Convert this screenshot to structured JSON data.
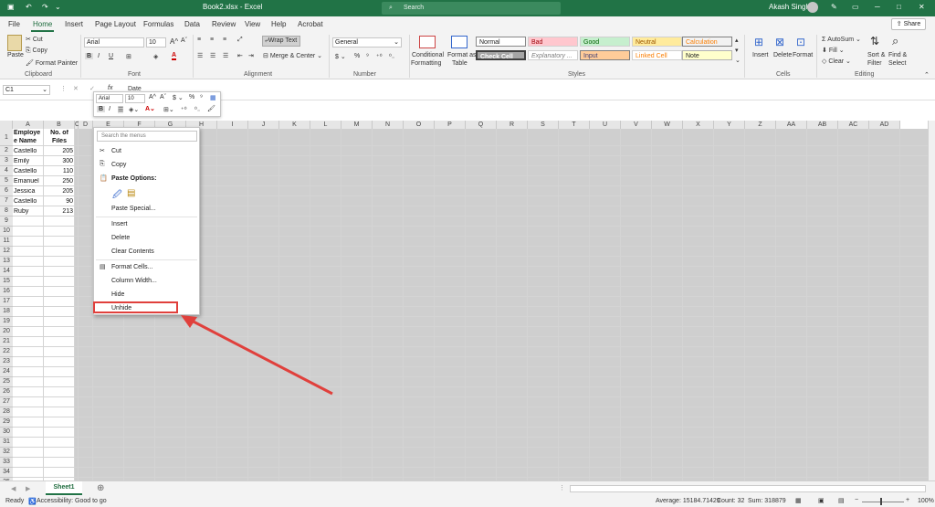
{
  "window": {
    "filename": "Book2.xlsx - Excel",
    "search_placeholder": "Search",
    "user": "Akash Singh"
  },
  "tabs": [
    "File",
    "Home",
    "Insert",
    "Page Layout",
    "Formulas",
    "Data",
    "Review",
    "View",
    "Help",
    "Acrobat"
  ],
  "share_label": "Share",
  "clipboard": {
    "paste": "Paste",
    "cut": "Cut",
    "copy": "Copy",
    "format_painter": "Format Painter",
    "group": "Clipboard"
  },
  "font": {
    "name": "Arial",
    "size": "10",
    "group": "Font"
  },
  "alignment": {
    "wrap": "Wrap Text",
    "merge": "Merge & Center",
    "group": "Alignment"
  },
  "number": {
    "format": "General",
    "group": "Number"
  },
  "styles": {
    "cf_line1": "Conditional",
    "cf_line2": "Formatting",
    "fat_line1": "Format as",
    "fat_line2": "Table",
    "normal": "Normal",
    "bad": "Bad",
    "good": "Good",
    "neutral": "Neutral",
    "calculation": "Calculation",
    "check_cell": "Check Cell",
    "explanatory": "Explanatory ...",
    "input": "Input",
    "linked": "Linked Cell",
    "note": "Note",
    "group": "Styles"
  },
  "cells": {
    "insert": "Insert",
    "delete": "Delete",
    "format": "Format",
    "group": "Cells"
  },
  "editing": {
    "autosum": "AutoSum",
    "fill": "Fill",
    "clear": "Clear",
    "sort_line1": "Sort &",
    "sort_line2": "Filter",
    "find_line1": "Find &",
    "find_line2": "Select",
    "group": "Editing"
  },
  "namebox": "C1",
  "formula_value": "Date",
  "columns": [
    "A",
    "B",
    "C",
    "D",
    "E",
    "F",
    "G",
    "H",
    "I",
    "J",
    "K",
    "L",
    "M",
    "N",
    "O",
    "P",
    "Q",
    "R",
    "S",
    "T",
    "U",
    "V",
    "W",
    "X",
    "Y",
    "Z",
    "AA",
    "AB",
    "AC",
    "AD",
    "AE"
  ],
  "rows": [
    "1",
    "2",
    "3",
    "4",
    "5",
    "6",
    "7",
    "8",
    "9",
    "10",
    "11",
    "12",
    "13",
    "14",
    "15",
    "16",
    "17",
    "18",
    "19",
    "20",
    "21",
    "22",
    "23",
    "24",
    "25",
    "26",
    "27",
    "28",
    "29",
    "30",
    "31",
    "32",
    "33",
    "34",
    "35"
  ],
  "table": {
    "header_a1": "Employe",
    "header_a2": "e Name",
    "header_b1": "No. of",
    "header_b2": "Files",
    "names": [
      "Castello",
      "Emily",
      "Castello",
      "Emanuel",
      "Jessica",
      "Castello",
      "Ruby"
    ],
    "files": [
      "205",
      "300",
      "110",
      "250",
      "205",
      "90",
      "213"
    ]
  },
  "mini_toolbar": {
    "font": "Arial",
    "size": "10"
  },
  "context_menu": {
    "search": "Search the menus",
    "cut": "Cut",
    "copy": "Copy",
    "paste_options": "Paste Options:",
    "paste_special": "Paste Special...",
    "insert": "Insert",
    "delete": "Delete",
    "clear": "Clear Contents",
    "format_cells": "Format Cells...",
    "col_width": "Column Width...",
    "hide": "Hide",
    "unhide": "Unhide"
  },
  "sheet_tab": "Sheet1",
  "status": {
    "ready": "Ready",
    "accessibility": "Accessibility: Good to go",
    "average": "Average: 15184.71429",
    "count": "Count: 32",
    "sum": "Sum: 318879",
    "zoom": "100%"
  },
  "colors": {
    "excel_green": "#217346",
    "highlight_red": "#e0403c"
  }
}
